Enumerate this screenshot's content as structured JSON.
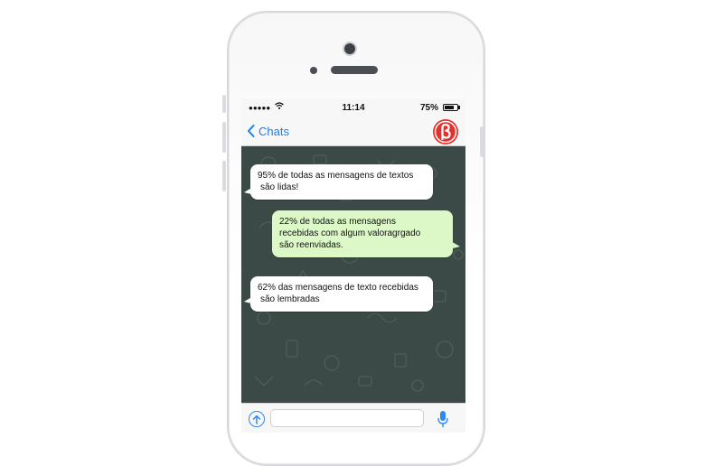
{
  "status_bar": {
    "signal_dots": "●●●●●",
    "time": "11:14",
    "battery_percent": "75%",
    "battery_level": 0.75
  },
  "nav": {
    "back_label": "Chats",
    "avatar_logo_letter": "ß",
    "icons": [
      "chevron-left-icon",
      "avatar-logo"
    ]
  },
  "messages": [
    {
      "direction": "incoming",
      "lines": [
        "95% de todas as mensagens de textos",
        "são lidas!"
      ]
    },
    {
      "direction": "outgoing",
      "lines": [
        "22% de todas as mensagens",
        "recebidas com algum valoragrgado",
        "são reenviadas."
      ]
    },
    {
      "direction": "incoming",
      "lines": [
        "62% das mensagens de texto recebidas",
        "são lembradas"
      ]
    }
  ],
  "input_bar": {
    "placeholder": "",
    "icons": [
      "attach-icon",
      "microphone-icon"
    ]
  },
  "colors": {
    "accent": "#1a7ff0",
    "chat_background": "#3b4a47",
    "incoming_bubble": "#ffffff",
    "outgoing_bubble": "#dcf8c6",
    "avatar": "#e3312d"
  }
}
